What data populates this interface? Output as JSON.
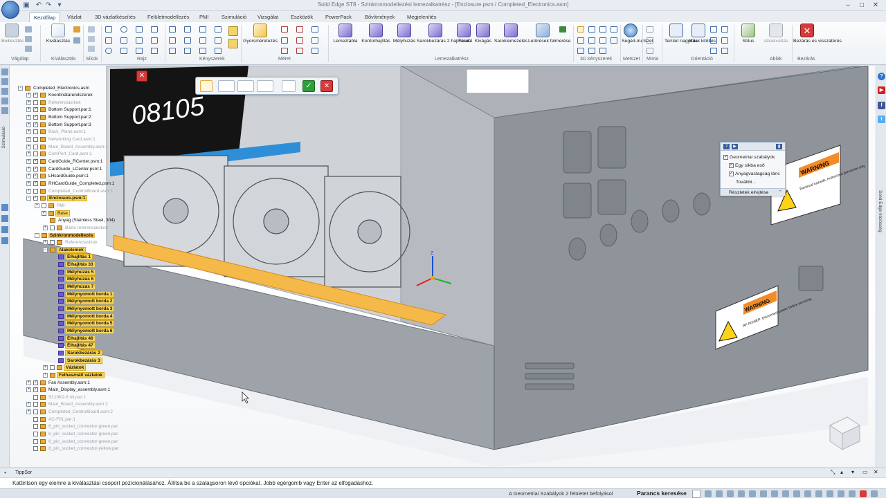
{
  "window": {
    "title": "Solid Edge ST8 - Szinkronmodellezési lemezalkatrész - [Enclosure.psm / Completed_Electronics.asm]"
  },
  "tabs": [
    {
      "label": "Kezdőlap",
      "active": true
    },
    {
      "label": "Vázlat"
    },
    {
      "label": "3D vázlatkészítés"
    },
    {
      "label": "Felületmodellezés"
    },
    {
      "label": "PMI"
    },
    {
      "label": "Szimuláció"
    },
    {
      "label": "Vizsgálat"
    },
    {
      "label": "Eszközök"
    },
    {
      "label": "PowerPack"
    },
    {
      "label": "Bővítmények"
    },
    {
      "label": "Megjelenítés"
    }
  ],
  "ribbon": {
    "buttons": {
      "beilleszes": "Beillesztés",
      "kivalasztas": "Kiválasztás",
      "gyorsmeretezes": "Gyorsméretezés",
      "lemeztabla": "Lemeztábla",
      "konturhajlitas": "Kontúrhajlítás",
      "melyhuzas": "Mélyhúzás",
      "sarokbezaras": "Sarokbezárás 2 hajlításnál",
      "furat": "Furat",
      "kivagas": "Kivágás",
      "saroklemezeles": "Saroklemezelés",
      "letorolesek": "Letörések felmerése",
      "segedmetszet": "Segéd-metszet",
      "teruletnagyitas": "Terület nagyítás",
      "ablakkitoltes": "Ablak kitöltés",
      "stilus": "Stílus",
      "ablakvaltas": "Ablakváltás",
      "bezaras": "Bezárás és visszatérés"
    },
    "groups": {
      "vagolap": "Vágólap",
      "kivalasztas": "Kiválasztás",
      "sikok": "Síkok",
      "rajz": "Rajz",
      "kenyszerek": "Kényszerek",
      "meret": "Méret",
      "lemezalkatresz": "Lemezalkatrész",
      "kenyszerek3d": "3D kényszerek",
      "metszet": "Metszet",
      "minta": "Minta",
      "orientacio": "Orientáció",
      "ablak": "Ablak",
      "bezaras": "Bezárás"
    }
  },
  "leftstrip": {
    "label": "Szimuláció"
  },
  "rightstrip": {
    "label": "Solid Edge közösség"
  },
  "tree": [
    {
      "label": "Completed_Electronics.asm",
      "level": 0,
      "exp": "-",
      "style": ""
    },
    {
      "label": "Koordinátarendszerek",
      "level": 1,
      "exp": "+",
      "cb": true,
      "style": ""
    },
    {
      "label": "Referenciasíkok",
      "level": 1,
      "exp": "+",
      "cb": false,
      "style": "dim"
    },
    {
      "label": "Bottom Support.par:1",
      "level": 1,
      "exp": "+",
      "cb": true,
      "style": ""
    },
    {
      "label": "Bottom Support.par:2",
      "level": 1,
      "exp": "+",
      "cb": true,
      "style": ""
    },
    {
      "label": "Bottom Support.par:3",
      "level": 1,
      "exp": "+",
      "cb": true,
      "style": ""
    },
    {
      "label": "Back_Plane.asm:1",
      "level": 1,
      "exp": "+",
      "cb": false,
      "style": "dim"
    },
    {
      "label": "Networking Card.asm:1",
      "level": 1,
      "exp": "+",
      "cb": false,
      "style": "dim"
    },
    {
      "label": "Main_Board_Assembly.asm:1",
      "level": 1,
      "exp": "+",
      "cb": false,
      "style": "dim"
    },
    {
      "label": "ComPort_Card.asm:1",
      "level": 1,
      "exp": "+",
      "cb": false,
      "style": "dim"
    },
    {
      "label": "CardGuide_RCenter.psm:1",
      "level": 1,
      "exp": "+",
      "cb": true,
      "style": ""
    },
    {
      "label": "CardGuide_LCenter.psm:1",
      "level": 1,
      "exp": "+",
      "cb": true,
      "style": ""
    },
    {
      "label": "LHcardGuide.psm:1",
      "level": 1,
      "exp": "+",
      "cb": true,
      "style": ""
    },
    {
      "label": "RHCardGuide_Completed.psm:1",
      "level": 1,
      "exp": "+",
      "cb": true,
      "style": ""
    },
    {
      "label": "Completed_ControlBoard.asm:1",
      "level": 1,
      "exp": "+",
      "cb": false,
      "style": "dim"
    },
    {
      "label": "Enclosure.psm:1",
      "level": 1,
      "exp": "-",
      "cb": true,
      "style": "hl bold"
    },
    {
      "label": "PMI",
      "level": 2,
      "exp": "+",
      "cb": false,
      "style": "dim"
    },
    {
      "label": "Base",
      "level": 2,
      "exp": "",
      "cb": true,
      "style": "hl"
    },
    {
      "label": "Anyag (Stainless Steel, 304)",
      "level": 3,
      "exp": "",
      "style": ""
    },
    {
      "label": "Bázis referenciasíkok",
      "level": 3,
      "exp": "+",
      "cb": false,
      "style": "dim"
    },
    {
      "label": "Szinkronmodellezés",
      "level": 2,
      "exp": "-",
      "style": "sel"
    },
    {
      "label": "Referenciasíkok",
      "level": 3,
      "exp": "+",
      "cb": false,
      "style": "dim"
    },
    {
      "label": "Alakelemek",
      "level": 3,
      "exp": "-",
      "style": "hl bold"
    },
    {
      "label": "Élhajlítás 1",
      "level": 4,
      "exp": "",
      "feat": true,
      "style": "hl bold"
    },
    {
      "label": "Élhajlítás 33",
      "level": 4,
      "exp": "",
      "feat": true,
      "style": "hl bold"
    },
    {
      "label": "Mélyhúzás 5",
      "level": 4,
      "exp": "",
      "feat": true,
      "style": "hl bold"
    },
    {
      "label": "Mélyhúzás 6",
      "level": 4,
      "exp": "",
      "feat": true,
      "style": "hl bold"
    },
    {
      "label": "Mélyhúzás 7",
      "level": 4,
      "exp": "",
      "feat": true,
      "style": "hl bold"
    },
    {
      "label": "Mélynyomott borda 1",
      "level": 4,
      "exp": "",
      "feat": true,
      "style": "hl bold"
    },
    {
      "label": "Mélynyomott borda 2",
      "level": 4,
      "exp": "",
      "feat": true,
      "style": "hl bold"
    },
    {
      "label": "Mélynyomott borda 3",
      "level": 4,
      "exp": "",
      "feat": true,
      "style": "hl bold"
    },
    {
      "label": "Mélynyomott borda 4",
      "level": 4,
      "exp": "",
      "feat": true,
      "style": "hl bold"
    },
    {
      "label": "Mélynyomott borda 5",
      "level": 4,
      "exp": "",
      "feat": true,
      "style": "hl bold"
    },
    {
      "label": "Mélynyomott borda 6",
      "level": 4,
      "exp": "",
      "feat": true,
      "style": "hl bold"
    },
    {
      "label": "Élhajlítás 46",
      "level": 4,
      "exp": "",
      "feat": true,
      "style": "hl bold"
    },
    {
      "label": "Élhajlítás 47",
      "level": 4,
      "exp": "",
      "feat": true,
      "style": "hl bold"
    },
    {
      "label": "Sarokbezárás 2",
      "level": 4,
      "exp": "",
      "feat": true,
      "style": "hl bold"
    },
    {
      "label": "Sarokbezárás 3",
      "level": 4,
      "exp": "",
      "feat": true,
      "style": "hl bold"
    },
    {
      "label": "Vázlatok",
      "level": 3,
      "exp": "+",
      "cb": false,
      "style": "hl bold"
    },
    {
      "label": "Felhasznált vázlatok",
      "level": 3,
      "exp": "+",
      "style": "hl bold"
    },
    {
      "label": "Fan Assembly.asm:1",
      "level": 1,
      "exp": "+",
      "cb": true,
      "style": ""
    },
    {
      "label": "Main_Display_assembly.asm:1",
      "level": 1,
      "exp": "+",
      "cb": true,
      "style": ""
    },
    {
      "label": "SL10K2-5 oil.par:1",
      "level": 1,
      "exp": "",
      "cb": false,
      "style": "dim"
    },
    {
      "label": "Main_Board_Assembly.asm:2",
      "level": 1,
      "exp": "+",
      "cb": false,
      "style": "dim"
    },
    {
      "label": "Completed_ControlBoard.asm:2",
      "level": 1,
      "exp": "+",
      "cb": false,
      "style": "dim"
    },
    {
      "label": "AC-F01.par:1",
      "level": 1,
      "exp": "",
      "cb": false,
      "style": "dim"
    },
    {
      "label": "8_pin_socket_connector-green.par",
      "level": 1,
      "exp": "",
      "cb": false,
      "style": "dim"
    },
    {
      "label": "8_pin_socket_connector-green.par",
      "level": 1,
      "exp": "",
      "cb": false,
      "style": "dim"
    },
    {
      "label": "8_pin_socket_connector-green.par",
      "level": 1,
      "exp": "",
      "cb": false,
      "style": "dim"
    },
    {
      "label": "8_pin_socket_connector-yellow.par",
      "level": 1,
      "exp": "",
      "cb": false,
      "style": "dim"
    }
  ],
  "liverules": {
    "options": [
      {
        "label": "Geometriai szabályok",
        "checked": true
      },
      {
        "label": "Egy síkba eső",
        "checked": true
      },
      {
        "label": "Anyagvastagság lánc",
        "checked": true
      },
      {
        "label": "További...",
        "checked": false
      }
    ],
    "details": "Részletek elrejtése"
  },
  "scene": {
    "display_text": "08105",
    "warning_title": "WARNING",
    "warning1_body": "Electrical hazards. Authorized personnel only.",
    "warning2_body": "RF POWER. Disconnect power before servicing.",
    "axis_z": "Z",
    "axis_x": "X",
    "axis_y": "Y"
  },
  "tipbar": {
    "label": "TippSor"
  },
  "message": "Kattintson egy elemre a kiválasztási csoport pozícionálásához. Állítsa be a szalagsoron lévő opciókat. Jobb egérgomb vagy Enter az elfogadáshoz.",
  "status": {
    "rules_info": "A Geometriai Szabályok 2 felületet befolyásol",
    "command_search": "Parancs keresése"
  }
}
